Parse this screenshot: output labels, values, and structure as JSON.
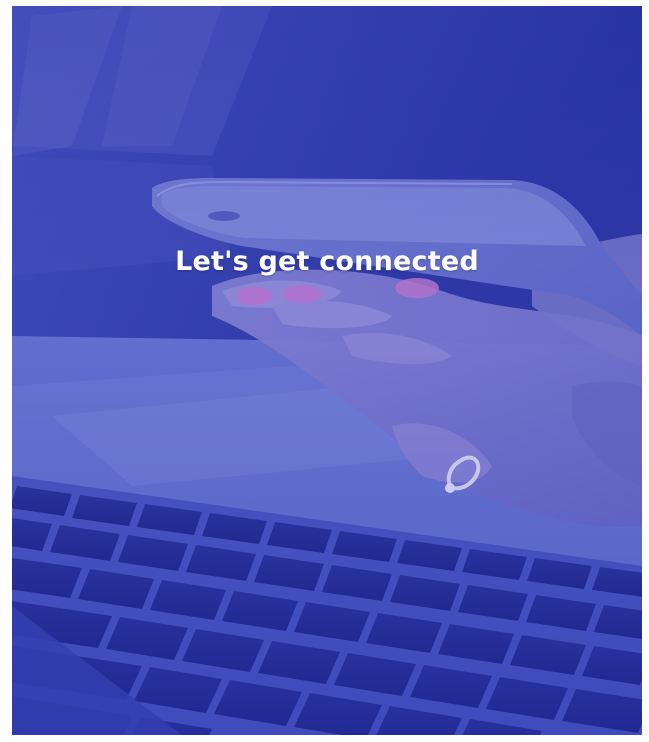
{
  "hero": {
    "headline": "Let's get connected",
    "background_image": "hand-holding-phone-over-laptop-keyboard",
    "overlay_color": "#2b36b8"
  }
}
